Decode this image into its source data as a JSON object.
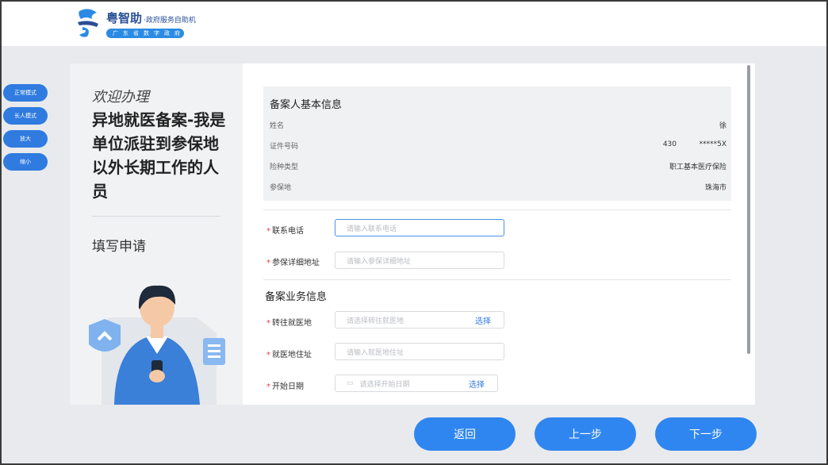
{
  "header": {
    "logo_name": "粤智助",
    "logo_sub": "·政府服务自助机",
    "logo_tag": "广东省数字政府"
  },
  "side_buttons": [
    "正常模式",
    "长人模式",
    "放大",
    "缩小"
  ],
  "left": {
    "welcome": "欢迎办理",
    "service_title": "异地就医备案-我是单位派驻到参保地以外长期工作的人员",
    "step": "填写申请"
  },
  "basic_info": {
    "title": "备案人基本信息",
    "rows": [
      {
        "label": "姓名",
        "value": "徐"
      },
      {
        "label": "证件号码",
        "value": "430          *****5X"
      },
      {
        "label": "险种类型",
        "value": "职工基本医疗保险"
      },
      {
        "label": "参保地",
        "value": "珠海市"
      }
    ]
  },
  "fields": {
    "phone": {
      "label": "联系电话",
      "placeholder": "请输入联系电话"
    },
    "address": {
      "label": "参保详细地址",
      "placeholder": "请输入参保详细地址"
    }
  },
  "business": {
    "title": "备案业务信息",
    "destination": {
      "label": "转往就医地",
      "placeholder": "请选择转往就医地",
      "pick": "选择"
    },
    "med_address": {
      "label": "就医地住址",
      "placeholder": "请输入就医地住址"
    },
    "start_date": {
      "label": "开始日期",
      "placeholder": "请选择开始日期",
      "pick": "选择"
    }
  },
  "nav": {
    "back": "返回",
    "prev": "上一步",
    "next": "下一步"
  },
  "colors": {
    "accent": "#2f86f0",
    "side_button": "#2f7be0",
    "required": "#e54040"
  }
}
